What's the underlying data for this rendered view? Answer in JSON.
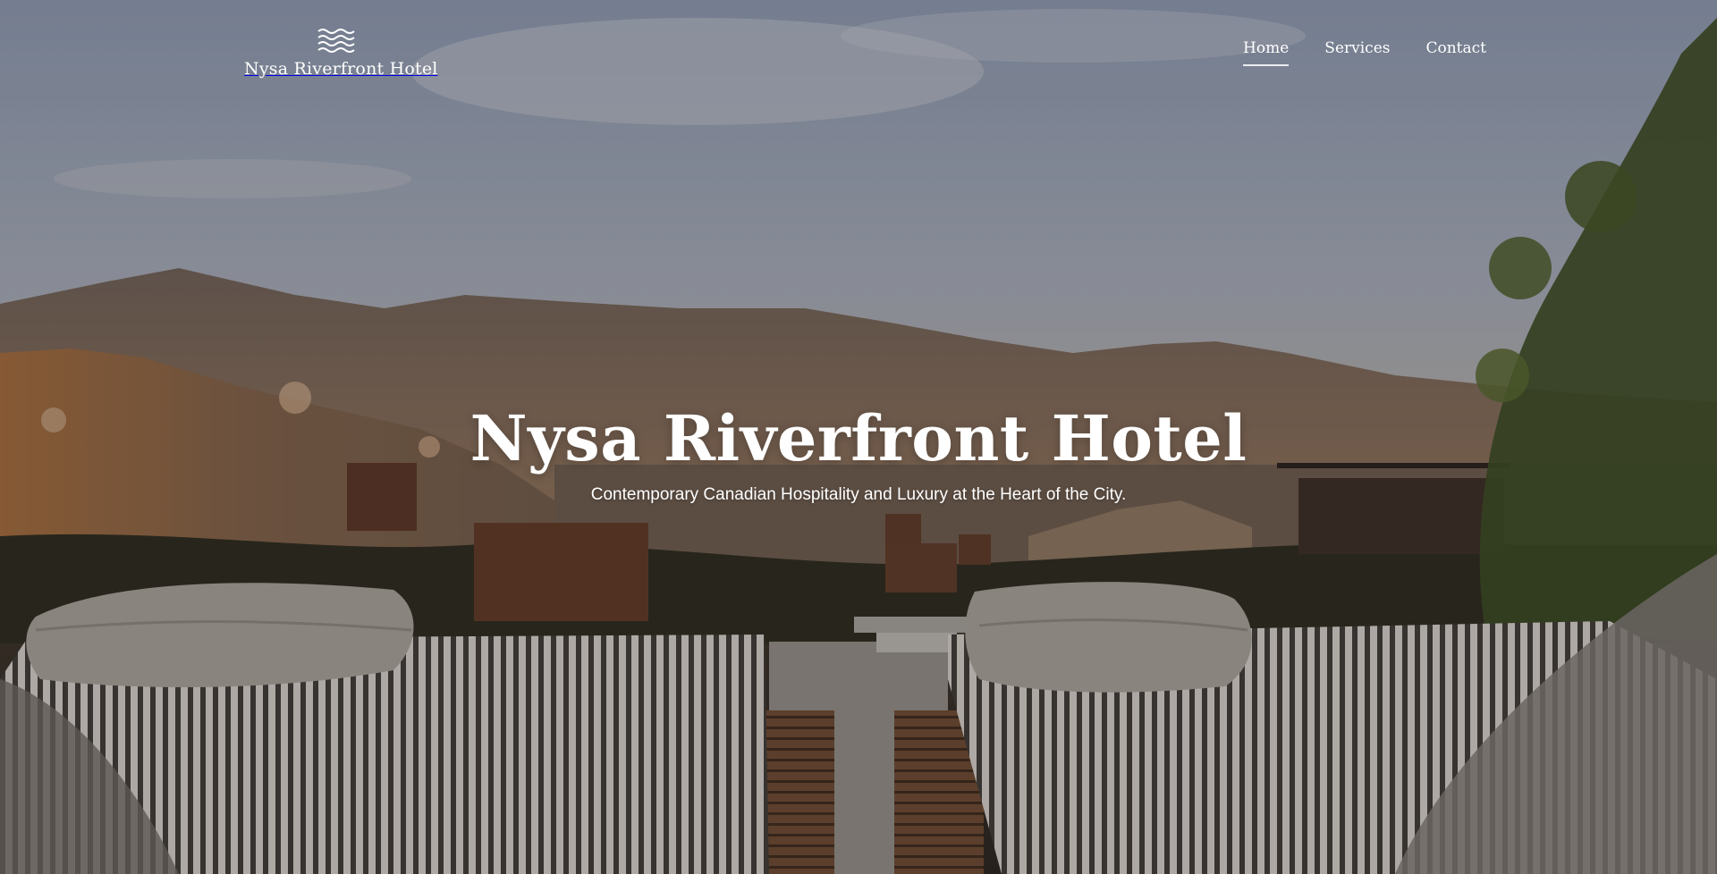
{
  "header": {
    "brand": {
      "name": "Nysa Riverfront Hotel",
      "logo_icon": "waves-icon"
    },
    "nav": [
      {
        "label": "Home",
        "active": true
      },
      {
        "label": "Services",
        "active": false
      },
      {
        "label": "Contact",
        "active": false
      }
    ]
  },
  "hero": {
    "title": "Nysa Riverfront Hotel",
    "subtitle": "Contemporary Canadian Hospitality and Luxury at the Heart of the City."
  },
  "colors": {
    "text": "#ffffff",
    "sky": "#9aa3b4",
    "mountain": "#6b5a4c",
    "foliage": "#3f4a2a"
  }
}
